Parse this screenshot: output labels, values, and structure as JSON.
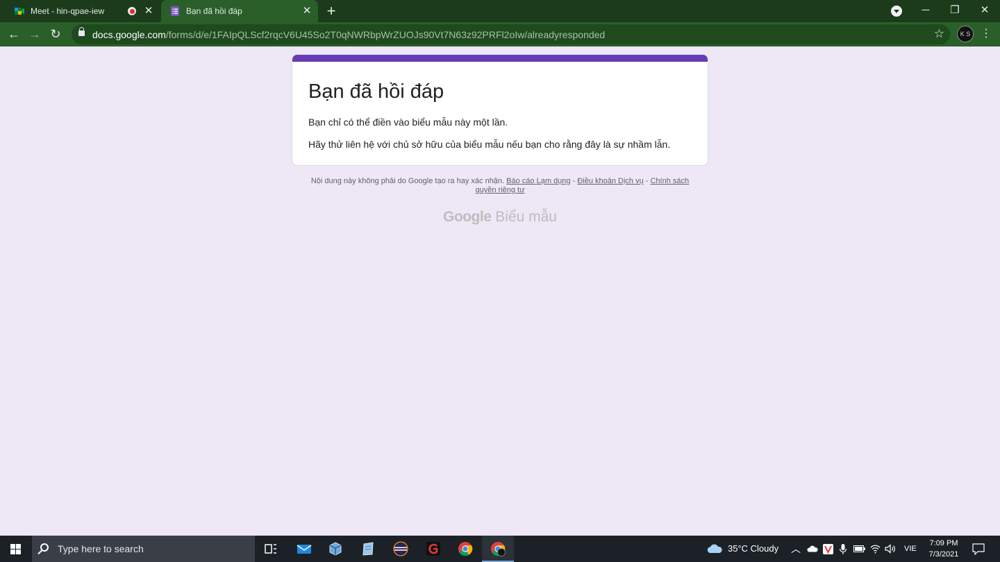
{
  "browser": {
    "tabs": [
      {
        "title": "Meet - hin-qpae-iew",
        "icon": "google-meet-icon",
        "recording": true,
        "active": false
      },
      {
        "title": "Bạn đã hồi đáp",
        "icon": "google-forms-icon",
        "active": true
      }
    ],
    "url_domain": "docs.google.com",
    "url_path": "/forms/d/e/1FAIpQLScf2rqcV6U45So2T0qNWRbpWrZUOJs90Vt7N63z92PRFl2oIw/alreadyresponded",
    "profile_initials": "K S"
  },
  "form": {
    "accent_color": "#673ab7",
    "title": "Bạn đã hồi đáp",
    "message_1": "Bạn chỉ có thể điền vào biểu mẫu này một lần.",
    "message_2": "Hãy thử liên hệ với chủ sở hữu của biểu mẫu nếu bạn cho rằng đây là sự nhầm lẫn."
  },
  "footer": {
    "disclaimer": "Nội dung này không phải do Google tạo ra hay xác nhận.",
    "report_abuse": "Báo cáo Lạm dụng",
    "sep": " - ",
    "terms": "Điều khoản Dịch vụ",
    "privacy": "Chính sách quyền riêng tư",
    "brand_google": "Google",
    "brand_product": "Biểu mẫu"
  },
  "taskbar": {
    "search_placeholder": "Type here to search",
    "weather": "35°C  Cloudy",
    "language": "VIE",
    "time": "7:09 PM",
    "date": "7/3/2021"
  }
}
